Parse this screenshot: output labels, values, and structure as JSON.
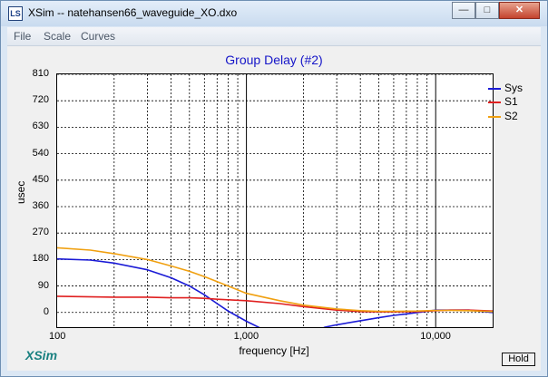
{
  "window": {
    "title": "XSim -- natehansen66_waveguide_XO.dxo",
    "app_icon_text": "LS",
    "minimize_symbol": "—",
    "maximize_symbol": "□",
    "close_symbol": "✕"
  },
  "menu": {
    "items": [
      "File",
      "Scale",
      "Curves"
    ]
  },
  "footer": {
    "brand": "XSim",
    "hold_label": "Hold"
  },
  "colors": {
    "Sys": "#1a1ad6",
    "S1": "#e02020",
    "S2": "#f0a010",
    "title": "#1515c8",
    "grid": "#000000"
  },
  "chart_data": {
    "type": "line",
    "title": "Group Delay (#2)",
    "xlabel": "frequency [Hz]",
    "ylabel": "usec",
    "xscale": "log",
    "xlim": [
      100,
      20000
    ],
    "ylim": [
      -50,
      810
    ],
    "yticks": [
      0,
      90,
      180,
      270,
      360,
      450,
      540,
      630,
      720,
      810
    ],
    "ytick_labels": [
      "0",
      "90",
      "180",
      "270",
      "360",
      "450",
      "540",
      "630",
      "720",
      "810"
    ],
    "xtick_labels": [
      {
        "value": 100,
        "label": "100"
      },
      {
        "value": 1000,
        "label": "1,000"
      },
      {
        "value": 10000,
        "label": "10,000"
      }
    ],
    "grid": true,
    "legend_position": "top-right",
    "series": [
      {
        "name": "Sys",
        "x": [
          100,
          150,
          200,
          300,
          400,
          500,
          600,
          700,
          800,
          1000,
          1200,
          1500,
          1800,
          2200,
          2600,
          3000,
          4000,
          5000,
          6000,
          7000,
          8000,
          10000,
          12000,
          15000,
          20000
        ],
        "y": [
          182,
          178,
          168,
          145,
          118,
          90,
          60,
          30,
          5,
          -30,
          -55,
          -78,
          -85,
          -70,
          -50,
          -42,
          -28,
          -18,
          -10,
          -5,
          0,
          8,
          8,
          8,
          0
        ]
      },
      {
        "name": "S1",
        "x": [
          100,
          200,
          300,
          400,
          500,
          600,
          700,
          800,
          1000,
          1500,
          2000,
          3000,
          4000,
          5000,
          6000,
          8000,
          10000,
          12000,
          15000,
          20000
        ],
        "y": [
          55,
          52,
          52,
          50,
          50,
          48,
          45,
          43,
          40,
          30,
          20,
          8,
          3,
          2,
          2,
          3,
          6,
          8,
          8,
          5
        ]
      },
      {
        "name": "S2",
        "x": [
          100,
          150,
          200,
          300,
          400,
          500,
          600,
          700,
          800,
          1000,
          1500,
          2000,
          3000,
          4000,
          5000,
          6000,
          8000,
          10000,
          12000,
          15000,
          20000
        ],
        "y": [
          220,
          212,
          200,
          180,
          158,
          140,
          122,
          105,
          90,
          65,
          40,
          25,
          12,
          6,
          4,
          4,
          5,
          7,
          7,
          6,
          3
        ]
      }
    ]
  }
}
